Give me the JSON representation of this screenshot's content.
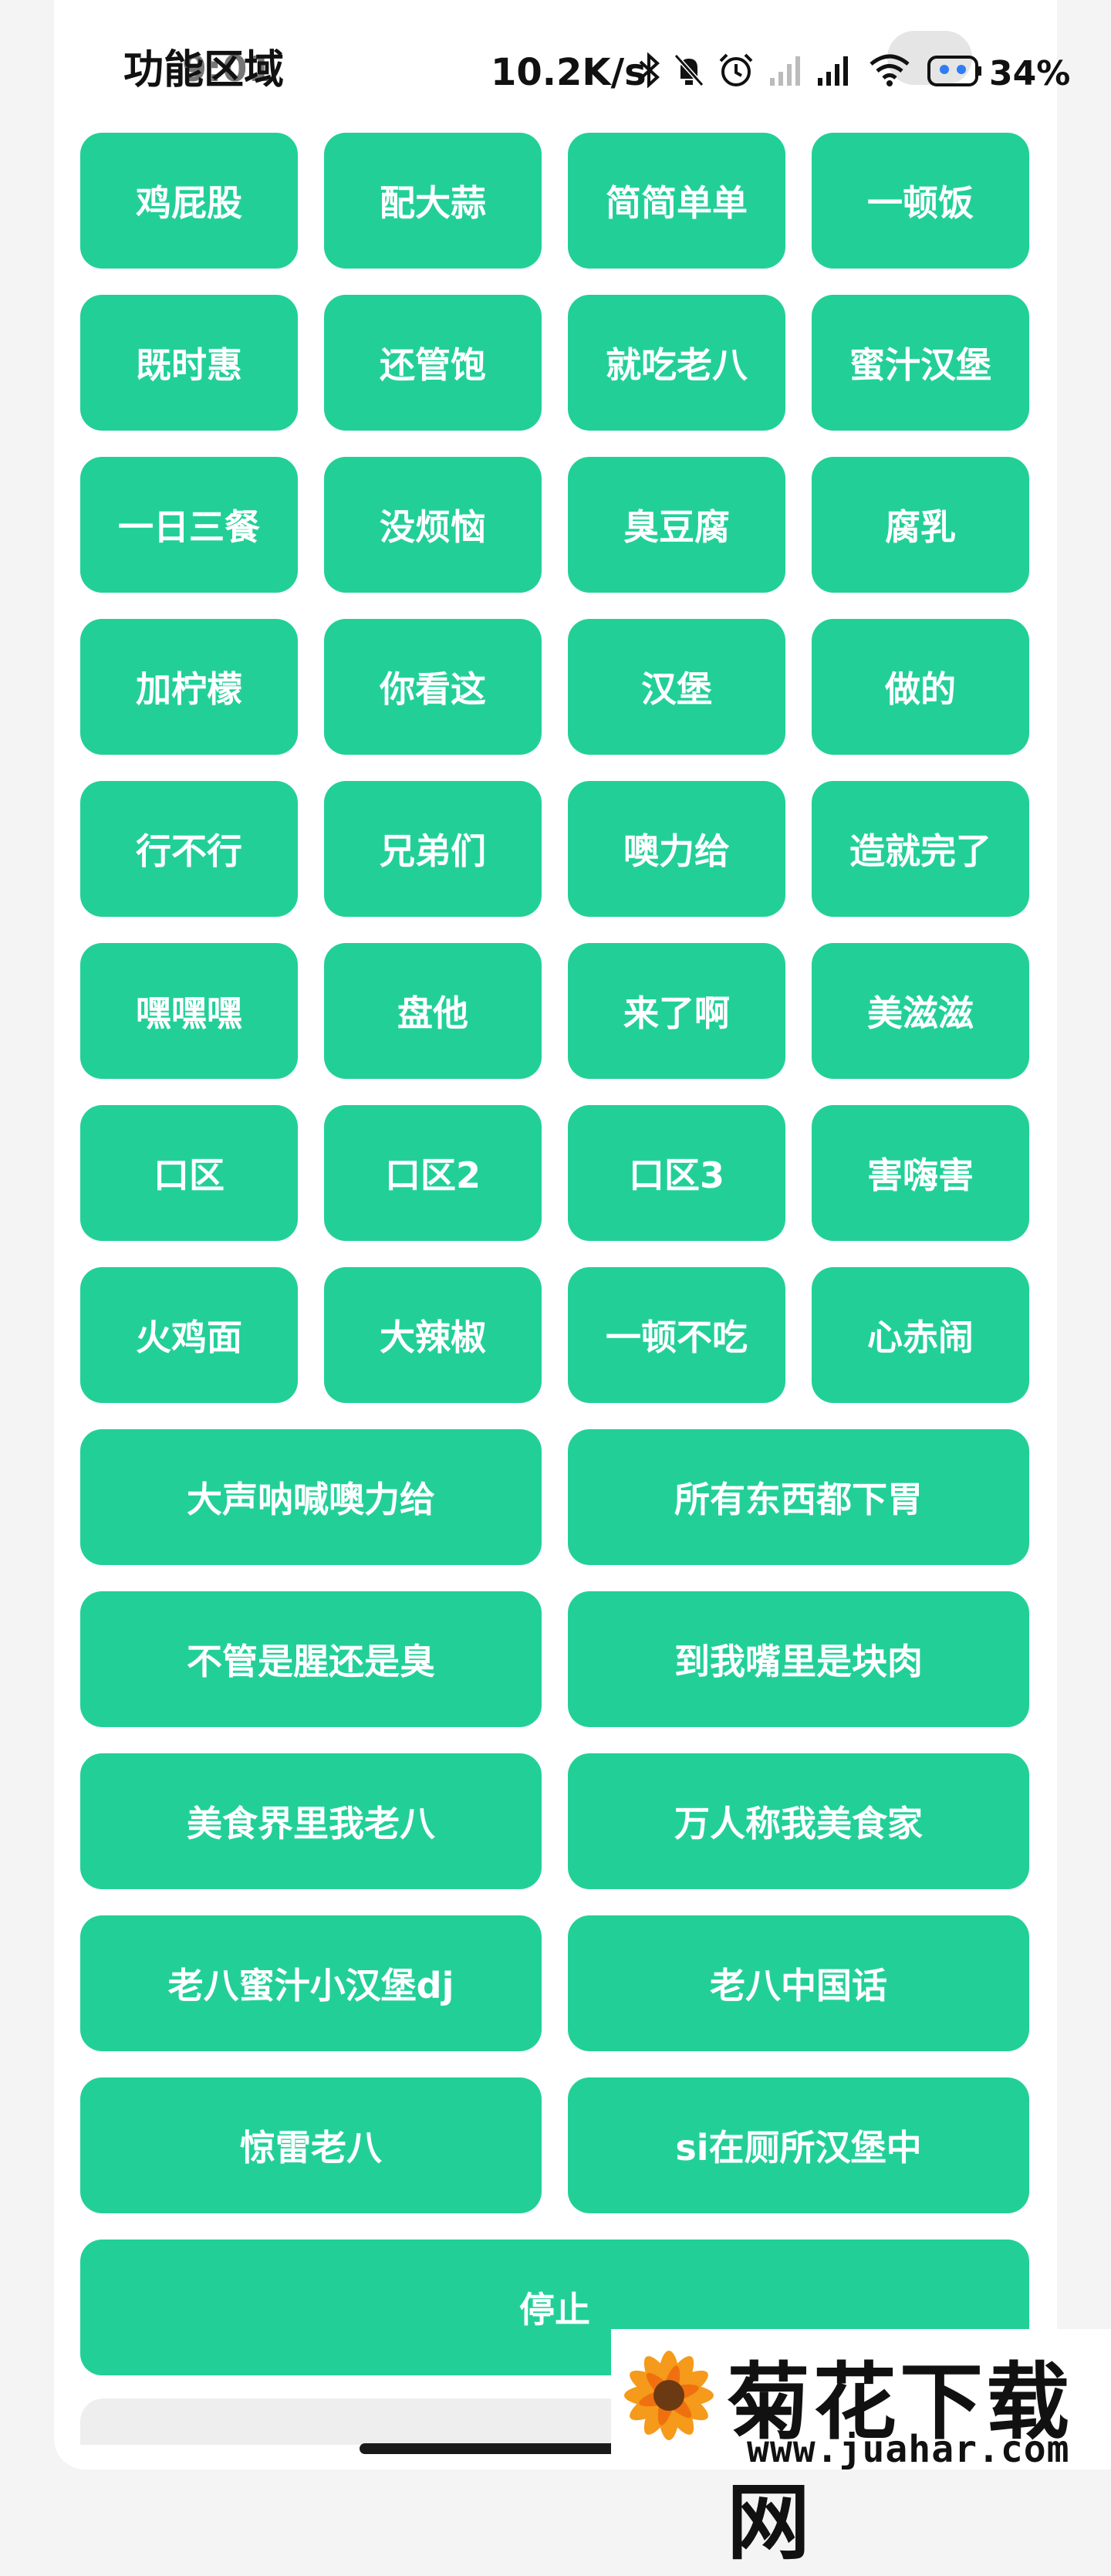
{
  "status_bar": {
    "time": "9:01",
    "network_speed": "10.2K/s",
    "battery": "34%",
    "icons": [
      "bluetooth-icon",
      "mute-icon",
      "alarm-icon",
      "signal-icon",
      "signal-icon",
      "wifi-icon",
      "robot-icon"
    ]
  },
  "header": {
    "title": "功能区域"
  },
  "buttons": [
    "鸡屁股",
    "配大蒜",
    "简简单单",
    "一顿饭",
    "既时惠",
    "还管饱",
    "就吃老八",
    "蜜汁汉堡",
    "一日三餐",
    "没烦恼",
    "臭豆腐",
    "腐乳",
    "加柠檬",
    "你看这",
    "汉堡",
    "做的",
    "行不行",
    "兄弟们",
    "噢力给",
    "造就完了",
    "嘿嘿嘿",
    "盘他",
    "来了啊",
    "美滋滋",
    "口区",
    "口区2",
    "口区3",
    "害嗨害",
    "火鸡面",
    "大辣椒",
    "一顿不吃",
    "心赤闹"
  ],
  "wide_buttons": [
    "大声呐喊噢力给",
    "所有东西都下胃",
    "不管是腥还是臭",
    "到我嘴里是块肉",
    "美食界里我老八",
    "万人称我美食家",
    "老八蜜汁小汉堡dj",
    "老八中国话",
    "惊雷老八",
    "si在厕所汉堡中"
  ],
  "stop_button": "停止",
  "watermark": {
    "name": "菊花下载网",
    "url": "www.juahar.com"
  },
  "colors": {
    "button": "#22d097",
    "background": "#ffffff"
  }
}
